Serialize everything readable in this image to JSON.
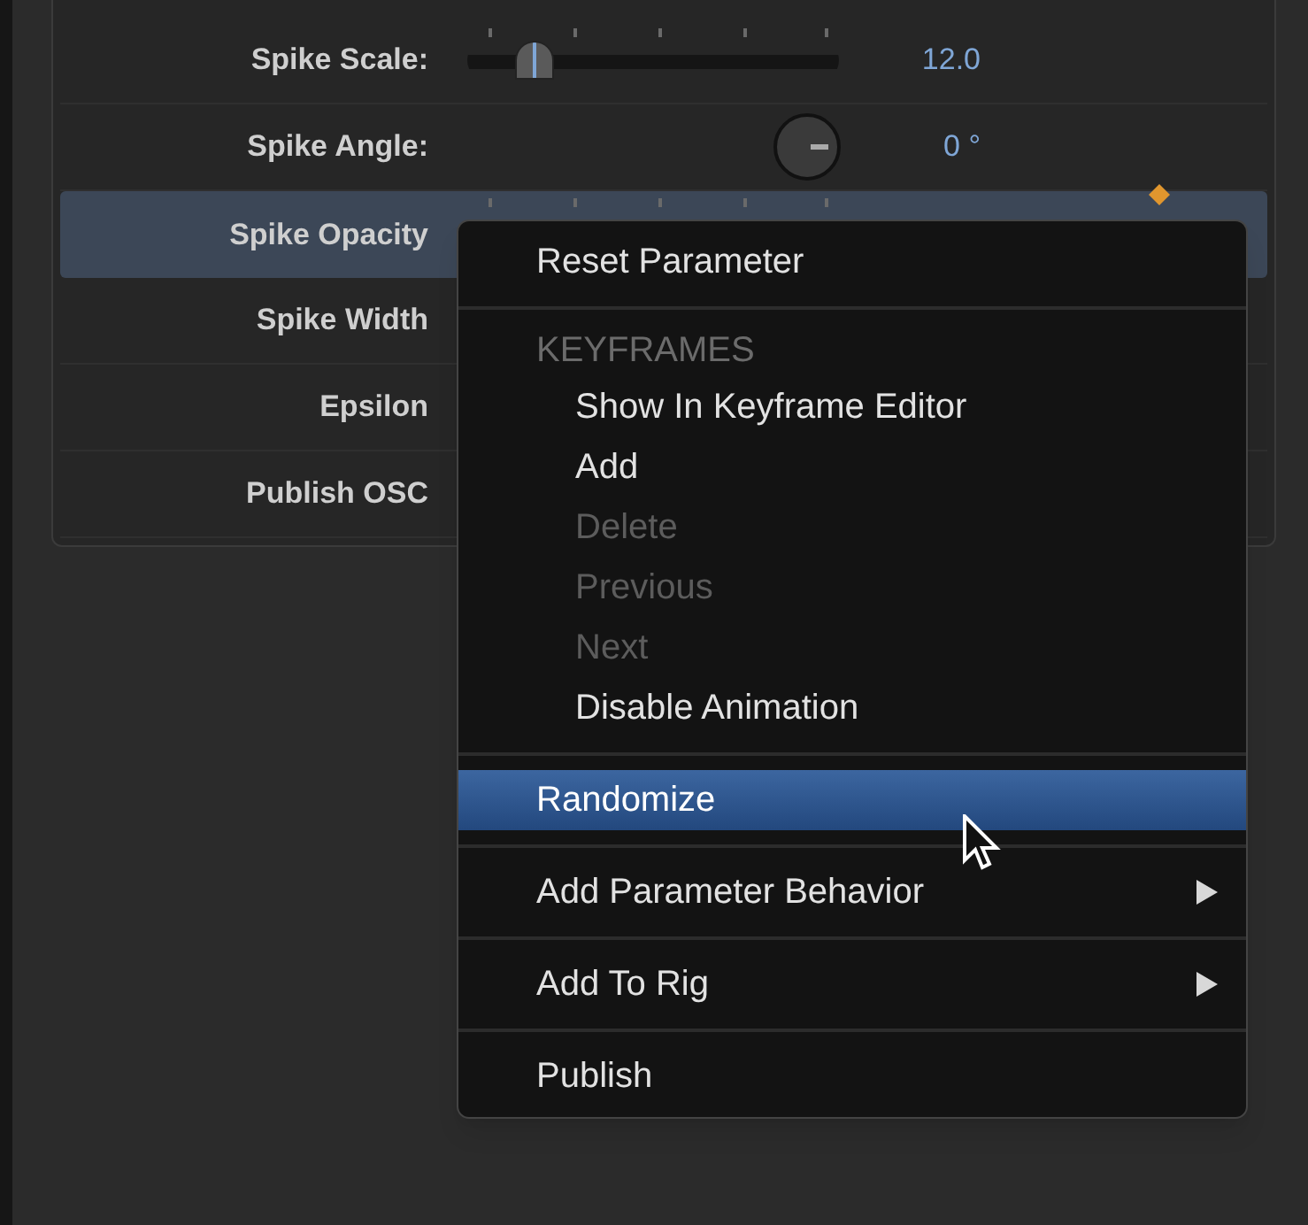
{
  "parameters": [
    {
      "label": "Spike Scale:",
      "kind": "slider",
      "level": 0.18,
      "value": "12.0",
      "selected": false
    },
    {
      "label": "Spike Angle:",
      "kind": "dial",
      "value": "0 °",
      "selected": false
    },
    {
      "label": "Spike Opacity",
      "kind": "slider_keyframed",
      "selected": true
    },
    {
      "label": "Spike Width",
      "kind": "plain",
      "selected": false
    },
    {
      "label": "Epsilon",
      "kind": "plain",
      "selected": false
    },
    {
      "label": "Publish OSC",
      "kind": "plain",
      "selected": false
    }
  ],
  "context_menu": {
    "items": [
      {
        "kind": "item",
        "label": "Reset Parameter",
        "disabled": false,
        "selected": false,
        "submenu": false,
        "indented": false
      },
      {
        "kind": "divider"
      },
      {
        "kind": "header",
        "label": "KEYFRAMES"
      },
      {
        "kind": "item",
        "label": "Show In Keyframe Editor",
        "disabled": false,
        "selected": false,
        "submenu": false,
        "indented": true
      },
      {
        "kind": "item",
        "label": "Add",
        "disabled": false,
        "selected": false,
        "submenu": false,
        "indented": true
      },
      {
        "kind": "item",
        "label": "Delete",
        "disabled": true,
        "selected": false,
        "submenu": false,
        "indented": true
      },
      {
        "kind": "item",
        "label": "Previous",
        "disabled": true,
        "selected": false,
        "submenu": false,
        "indented": true
      },
      {
        "kind": "item",
        "label": "Next",
        "disabled": true,
        "selected": false,
        "submenu": false,
        "indented": true
      },
      {
        "kind": "item",
        "label": "Disable Animation",
        "disabled": false,
        "selected": false,
        "submenu": false,
        "indented": true
      },
      {
        "kind": "divider"
      },
      {
        "kind": "item",
        "label": "Randomize",
        "disabled": false,
        "selected": true,
        "submenu": false,
        "indented": false
      },
      {
        "kind": "divider"
      },
      {
        "kind": "item",
        "label": "Add Parameter Behavior",
        "disabled": false,
        "selected": false,
        "submenu": true,
        "indented": false
      },
      {
        "kind": "divider"
      },
      {
        "kind": "item",
        "label": "Add To Rig",
        "disabled": false,
        "selected": false,
        "submenu": true,
        "indented": false
      },
      {
        "kind": "divider"
      },
      {
        "kind": "item",
        "label": "Publish",
        "disabled": false,
        "selected": false,
        "submenu": false,
        "indented": false
      }
    ]
  }
}
